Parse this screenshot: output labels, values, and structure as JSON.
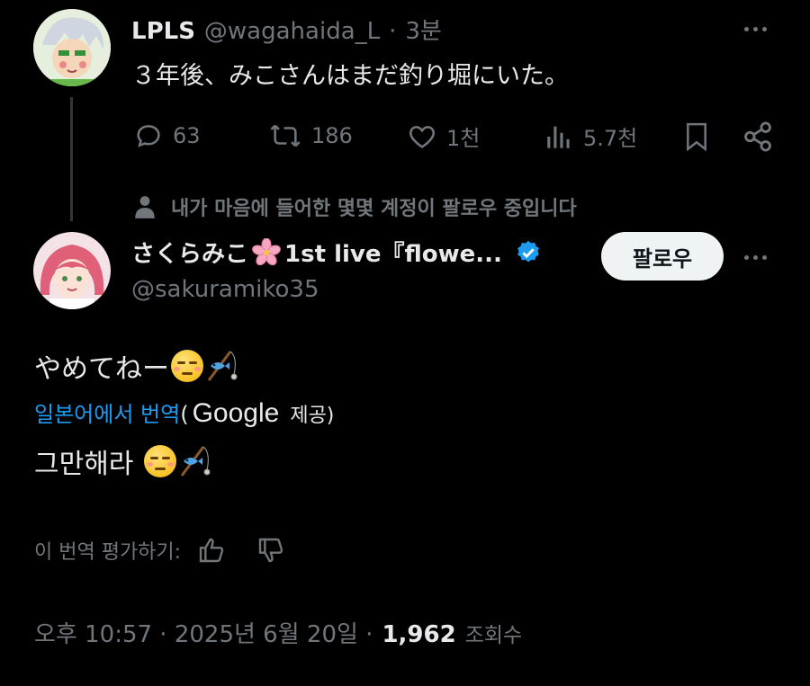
{
  "top_tweet": {
    "display_name": "LPLS",
    "handle": "@wagahaida_L",
    "separator": "·",
    "time": "3분",
    "text": "３年後、みこさんはまだ釣り堀にいた。",
    "actions": {
      "replies": "63",
      "reposts": "186",
      "likes": "1천",
      "views": "5.7천"
    }
  },
  "social_context": "내가 마음에 들어한 몇몇 계정이 팔로우 중입니다",
  "main_tweet": {
    "display_name": "さくらみこ",
    "display_name_suffix": "1st live『flowe...",
    "handle": "@sakuramiko35",
    "follow_label": "팔로우",
    "text": "やめてねー",
    "translate_link": "일본어에서 번역",
    "translate_paren_open": "(",
    "translate_provider": "Google",
    "translate_provider_suffix": "제공)",
    "translated_text": "그만해라",
    "rate_label": "이 번역 평가하기:",
    "timestamp": "오후 10:57 · 2025년 6월 20일 ·",
    "view_count": "1,962",
    "view_label": "조회수"
  },
  "colors": {
    "background": "#000000",
    "text": "#e7e9ea",
    "muted": "#71767b",
    "link": "#1d9bf0",
    "verified": "#1d9bf0"
  }
}
